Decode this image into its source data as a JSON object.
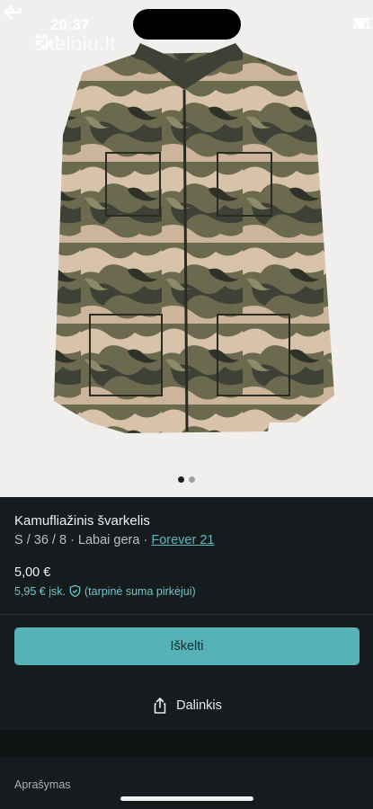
{
  "status_bar": {
    "time": "20:37"
  },
  "watermark": {
    "text": "skelbiu.lt"
  },
  "gallery": {
    "image_count": 2,
    "active_index": 0
  },
  "listing": {
    "title": "Kamufliažinis švarkelis",
    "size_condition": "S / 36 / 8 · Labai gera · ",
    "brand": "Forever 21",
    "price": "5,00 €",
    "buyer_price": "5,95 € įsk.",
    "buyer_price_note": "(tarpinė suma pirkėjui)"
  },
  "actions": {
    "primary_label": "Iškelti",
    "share_label": "Dalinkis"
  },
  "description": {
    "label": "Aprašymas"
  },
  "icons": {
    "back": "arrow-left-icon",
    "more": "more-horizontal-icon",
    "share": "share-icon",
    "shield": "shield-check-icon"
  },
  "colors": {
    "accent": "#55b3b8",
    "link": "#5ab8c0",
    "background": "#161b1d"
  }
}
